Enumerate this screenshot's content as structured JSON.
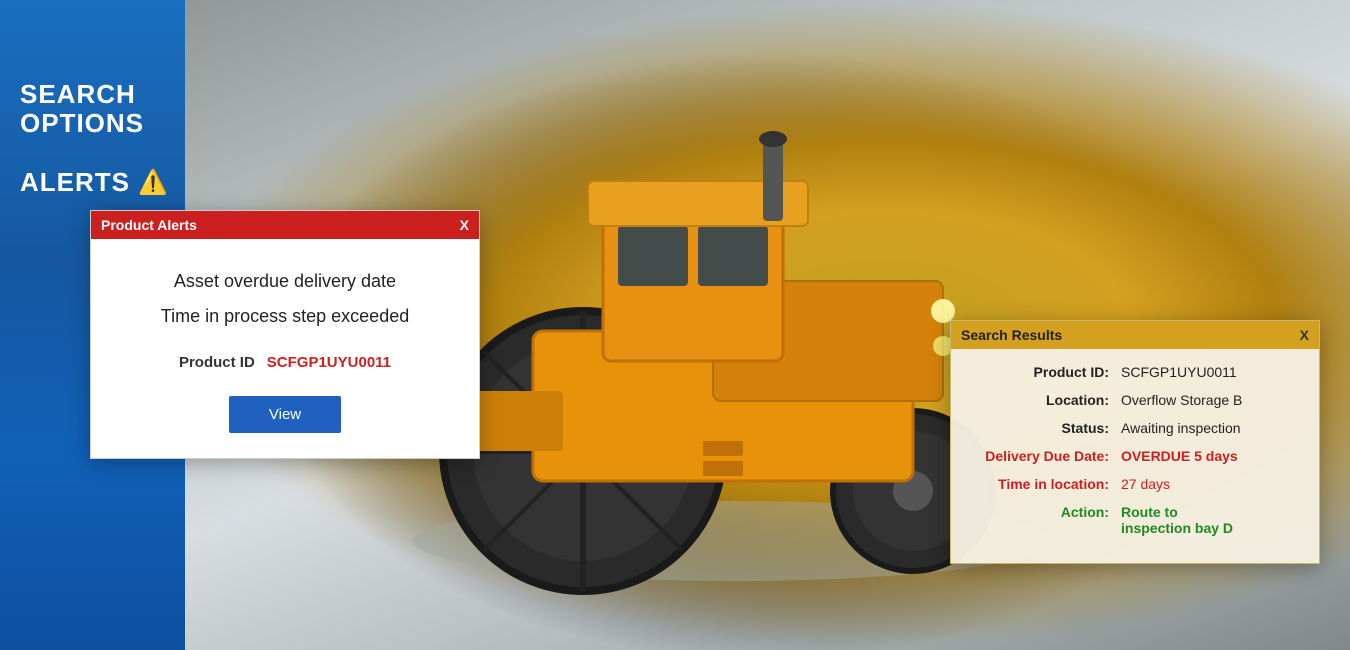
{
  "sidebar": {
    "search_title": "SEARCH\nOPTIONS",
    "search_line1": "SEARCH",
    "search_line2": "OPTIONS",
    "alerts_label": "ALERTS",
    "alert_icon": "⚠️"
  },
  "product_alerts_dialog": {
    "title": "Product Alerts",
    "close_btn": "X",
    "message1": "Asset overdue delivery date",
    "message2": "Time in process step exceeded",
    "product_id_label": "Product ID",
    "product_id_value": "SCFGP1UYU0011",
    "view_button": "View"
  },
  "search_results": {
    "title": "Search Results",
    "close_btn": "X",
    "rows": [
      {
        "label": "Product ID:",
        "value": "SCFGP1UYU0011",
        "style": "normal"
      },
      {
        "label": "Location:",
        "value": "Overflow Storage B",
        "style": "normal"
      },
      {
        "label": "Status:",
        "value": "Awaiting inspection",
        "style": "normal"
      },
      {
        "label": "Delivery Due Date:",
        "value": "OVERDUE 5 days",
        "style": "overdue",
        "label_style": "overdue"
      },
      {
        "label": "Time in location:",
        "value": "27 days",
        "style": "warning",
        "label_style": "time"
      },
      {
        "label": "Action:",
        "value": "Route to\ninspection bay D",
        "style": "action",
        "label_style": "action"
      }
    ]
  }
}
